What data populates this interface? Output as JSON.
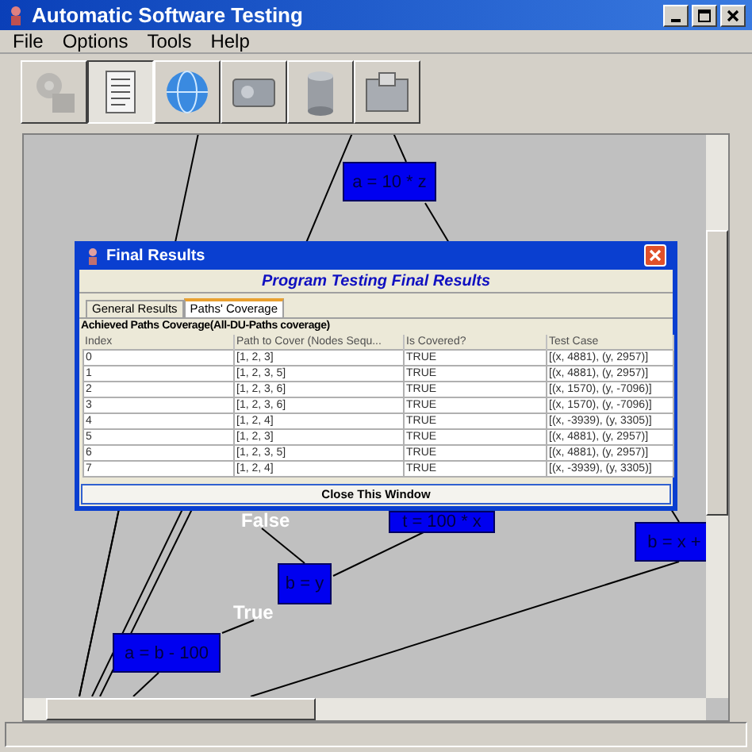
{
  "window": {
    "title": "Automatic Software Testing"
  },
  "menu": [
    "File",
    "Options",
    "Tools",
    "Help"
  ],
  "toolbar": [
    {
      "kind": "gears",
      "selected": false,
      "disabled": true
    },
    {
      "kind": "document",
      "selected": true,
      "disabled": false
    },
    {
      "kind": "globe",
      "selected": false,
      "disabled": false
    },
    {
      "kind": "card",
      "selected": false,
      "disabled": false
    },
    {
      "kind": "cylinder",
      "selected": false,
      "disabled": false
    },
    {
      "kind": "folder",
      "selected": false,
      "disabled": false
    }
  ],
  "graph": {
    "nodes": [
      "a = 10 * z",
      "t = 100 * x",
      "b = y",
      "a = b - 100",
      "b = x +"
    ],
    "edge_labels": [
      "False",
      "True"
    ]
  },
  "dialog": {
    "title": "Final Results",
    "heading": "Program Testing Final Results",
    "tabs": [
      {
        "label": "General Results",
        "selected": false
      },
      {
        "label": "Paths' Coverage",
        "selected": true
      }
    ],
    "caption": "Achieved Paths Coverage(All-DU-Paths coverage)",
    "table": {
      "columns": [
        "Index",
        "Path to Cover (Nodes Sequ...",
        "Is Covered?",
        "Test Case"
      ],
      "rows": [
        [
          "0",
          "[1, 2, 3]",
          "TRUE",
          "[(x, 4881), (y, 2957)]"
        ],
        [
          "1",
          "[1, 2, 3, 5]",
          "TRUE",
          "[(x, 4881), (y, 2957)]"
        ],
        [
          "2",
          "[1, 2, 3, 6]",
          "TRUE",
          "[(x, 1570), (y, -7096)]"
        ],
        [
          "3",
          "[1, 2, 3, 6]",
          "TRUE",
          "[(x, 1570), (y, -7096)]"
        ],
        [
          "4",
          "[1, 2, 4]",
          "TRUE",
          "[(x, -3939), (y, 3305)]"
        ],
        [
          "5",
          "[1, 2, 3]",
          "TRUE",
          "[(x, 4881), (y, 2957)]"
        ],
        [
          "6",
          "[1, 2, 3, 5]",
          "TRUE",
          "[(x, 4881), (y, 2957)]"
        ],
        [
          "7",
          "[1, 2, 4]",
          "TRUE",
          "[(x, -3939), (y, 3305)]"
        ]
      ]
    },
    "close_button": "Close This Window"
  }
}
